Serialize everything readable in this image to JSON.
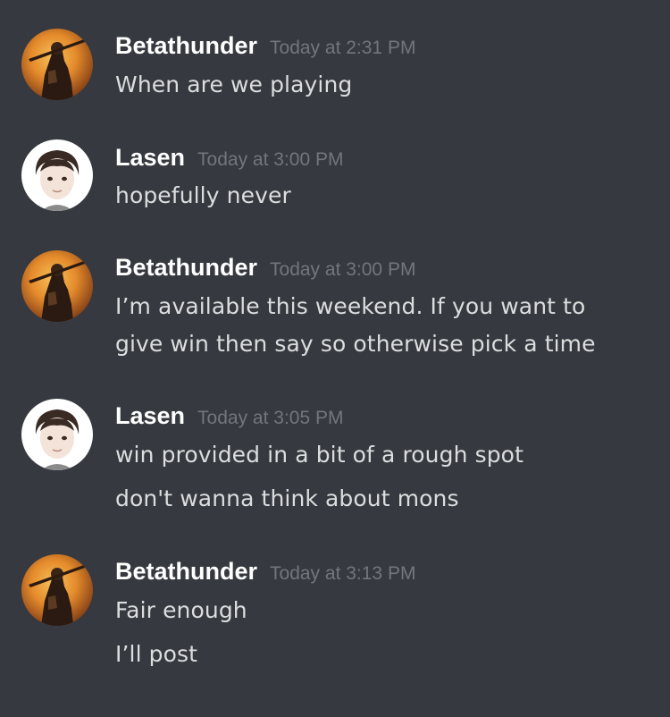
{
  "colors": {
    "background": "#36393f",
    "username": "#ffffff",
    "timestamp": "#72767d",
    "message_text": "#dcddde"
  },
  "messages": [
    {
      "author": "Betathunder",
      "avatar": "knight-avatar-icon",
      "timestamp": "Today at 2:31 PM",
      "lines": [
        "When are we playing"
      ]
    },
    {
      "author": "Lasen",
      "avatar": "anime-boy-avatar-icon",
      "timestamp": "Today at 3:00 PM",
      "lines": [
        "hopefully never"
      ]
    },
    {
      "author": "Betathunder",
      "avatar": "knight-avatar-icon",
      "timestamp": "Today at 3:00 PM",
      "lines": [
        "I’m available this weekend. If you want to",
        "give win then say so otherwise pick a time"
      ]
    },
    {
      "author": "Lasen",
      "avatar": "anime-boy-avatar-icon",
      "timestamp": "Today at 3:05 PM",
      "lines": [
        "win provided in a bit of a rough spot",
        "don't wanna think about mons"
      ]
    },
    {
      "author": "Betathunder",
      "avatar": "knight-avatar-icon",
      "timestamp": "Today at 3:13 PM",
      "lines": [
        "Fair enough",
        "I’ll post"
      ]
    }
  ]
}
